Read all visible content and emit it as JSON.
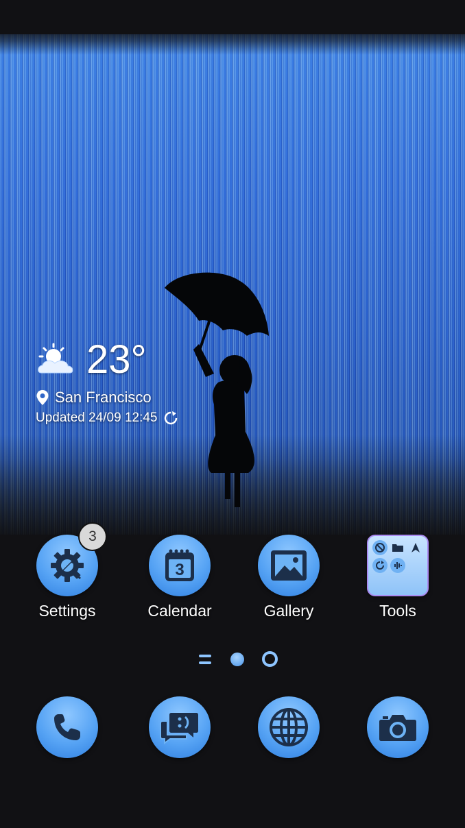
{
  "weather": {
    "temperature": "23°",
    "city": "San Francisco",
    "updated": "Updated 24/09 12:45",
    "condition_icon": "partly-cloudy-icon"
  },
  "apps": [
    {
      "label": "Settings",
      "icon": "gear-wrench-icon",
      "badge": "3"
    },
    {
      "label": "Calendar",
      "icon": "calendar-icon",
      "day": "3"
    },
    {
      "label": "Gallery",
      "icon": "picture-icon"
    },
    {
      "label": "Tools",
      "icon": "folder-icon"
    }
  ],
  "dock": [
    {
      "icon": "phone-icon"
    },
    {
      "icon": "messages-icon"
    },
    {
      "icon": "browser-globe-icon"
    },
    {
      "icon": "camera-icon"
    }
  ],
  "pager": {
    "pages": 3,
    "current": 2
  },
  "colors": {
    "icon_blue": "#56a3f4",
    "icon_dark": "#1c2f4a",
    "background": "#111114"
  }
}
